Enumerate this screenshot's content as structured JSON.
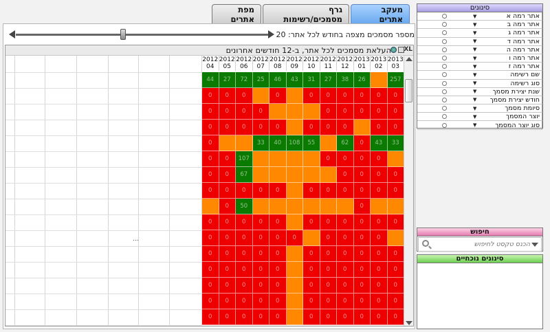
{
  "tabs": [
    {
      "label": "מפת אתרים",
      "active": false
    },
    {
      "label": "גרף מסמכים/רשימות",
      "active": false
    },
    {
      "label": "מעקב אתרים",
      "active": true
    }
  ],
  "slider": {
    "label": "מספר מסמכים מצפה בחודש לכל אתר: 20",
    "value": 20
  },
  "grid": {
    "title": "העלאת מסמכים לכל אתר, ב-12 חודשים אחרונים",
    "export_label": "XL",
    "ellipsis": "...",
    "months": [
      {
        "year": "2012",
        "month": "04"
      },
      {
        "year": "2012",
        "month": "05"
      },
      {
        "year": "2012",
        "month": "06"
      },
      {
        "year": "2012",
        "month": "07"
      },
      {
        "year": "2012",
        "month": "08"
      },
      {
        "year": "2012",
        "month": "09"
      },
      {
        "year": "2012",
        "month": "10"
      },
      {
        "year": "2012",
        "month": "11"
      },
      {
        "year": "2012",
        "month": "12"
      },
      {
        "year": "2013",
        "month": "01"
      },
      {
        "year": "2013",
        "month": "02"
      },
      {
        "year": "2013",
        "month": "03"
      }
    ],
    "rows": [
      [
        [
          "g",
          "44"
        ],
        [
          "g",
          "27"
        ],
        [
          "g",
          "72"
        ],
        [
          "g",
          "25"
        ],
        [
          "g",
          "46"
        ],
        [
          "g",
          "43"
        ],
        [
          "g",
          "31"
        ],
        [
          "g",
          "27"
        ],
        [
          "g",
          "38"
        ],
        [
          "g",
          "26"
        ],
        [
          "o",
          ""
        ],
        [
          "g",
          "257"
        ]
      ],
      [
        [
          "r",
          "0"
        ],
        [
          "r",
          "0"
        ],
        [
          "r",
          "0"
        ],
        [
          "o",
          ""
        ],
        [
          "r",
          "0"
        ],
        [
          "o",
          ""
        ],
        [
          "r",
          "0"
        ],
        [
          "r",
          "0"
        ],
        [
          "r",
          "0"
        ],
        [
          "r",
          "0"
        ],
        [
          "r",
          "0"
        ],
        [
          "r",
          "0"
        ]
      ],
      [
        [
          "r",
          "0"
        ],
        [
          "r",
          "0"
        ],
        [
          "r",
          "0"
        ],
        [
          "r",
          "0"
        ],
        [
          "o",
          ""
        ],
        [
          "o",
          ""
        ],
        [
          "o",
          ""
        ],
        [
          "r",
          "0"
        ],
        [
          "r",
          "0"
        ],
        [
          "r",
          "0"
        ],
        [
          "r",
          "0"
        ],
        [
          "r",
          "0"
        ]
      ],
      [
        [
          "r",
          "0"
        ],
        [
          "r",
          "0"
        ],
        [
          "r",
          "0"
        ],
        [
          "r",
          "0"
        ],
        [
          "r",
          "0"
        ],
        [
          "o",
          ""
        ],
        [
          "r",
          "0"
        ],
        [
          "r",
          "0"
        ],
        [
          "r",
          "0"
        ],
        [
          "o",
          ""
        ],
        [
          "r",
          "0"
        ],
        [
          "r",
          "0"
        ]
      ],
      [
        [
          "r",
          "0"
        ],
        [
          "o",
          ""
        ],
        [
          "o",
          ""
        ],
        [
          "g",
          "33"
        ],
        [
          "g",
          "40"
        ],
        [
          "g",
          "108"
        ],
        [
          "g",
          "55"
        ],
        [
          "o",
          ""
        ],
        [
          "g",
          "62"
        ],
        [
          "r",
          "0"
        ],
        [
          "g",
          "43"
        ],
        [
          "g",
          "33"
        ]
      ],
      [
        [
          "r",
          "0"
        ],
        [
          "r",
          "0"
        ],
        [
          "g",
          "107"
        ],
        [
          "o",
          ""
        ],
        [
          "o",
          ""
        ],
        [
          "o",
          ""
        ],
        [
          "o",
          ""
        ],
        [
          "r",
          "0"
        ],
        [
          "r",
          "0"
        ],
        [
          "r",
          "0"
        ],
        [
          "r",
          "0"
        ],
        [
          "o",
          ""
        ]
      ],
      [
        [
          "r",
          "0"
        ],
        [
          "r",
          "0"
        ],
        [
          "g",
          "67"
        ],
        [
          "o",
          ""
        ],
        [
          "o",
          ""
        ],
        [
          "o",
          ""
        ],
        [
          "o",
          ""
        ],
        [
          "o",
          ""
        ],
        [
          "r",
          "0"
        ],
        [
          "r",
          "0"
        ],
        [
          "r",
          "0"
        ],
        [
          "r",
          "0"
        ]
      ],
      [
        [
          "r",
          "0"
        ],
        [
          "r",
          "0"
        ],
        [
          "r",
          "0"
        ],
        [
          "r",
          "0"
        ],
        [
          "r",
          "0"
        ],
        [
          "o",
          ""
        ],
        [
          "r",
          "0"
        ],
        [
          "r",
          "0"
        ],
        [
          "r",
          "0"
        ],
        [
          "r",
          "0"
        ],
        [
          "r",
          "0"
        ],
        [
          "r",
          "0"
        ]
      ],
      [
        [
          "o",
          ""
        ],
        [
          "r",
          "0"
        ],
        [
          "g",
          "50"
        ],
        [
          "o",
          ""
        ],
        [
          "o",
          ""
        ],
        [
          "o",
          ""
        ],
        [
          "o",
          ""
        ],
        [
          "o",
          ""
        ],
        [
          "o",
          ""
        ],
        [
          "r",
          "0"
        ],
        [
          "o",
          ""
        ],
        [
          "o",
          ""
        ]
      ],
      [
        [
          "r",
          "0"
        ],
        [
          "r",
          "0"
        ],
        [
          "r",
          "0"
        ],
        [
          "r",
          "0"
        ],
        [
          "r",
          "0"
        ],
        [
          "o",
          ""
        ],
        [
          "r",
          "0"
        ],
        [
          "r",
          "0"
        ],
        [
          "r",
          "0"
        ],
        [
          "r",
          "0"
        ],
        [
          "r",
          "0"
        ],
        [
          "r",
          "0"
        ]
      ],
      [
        [
          "r",
          "0"
        ],
        [
          "r",
          "0"
        ],
        [
          "r",
          "0"
        ],
        [
          "r",
          "0"
        ],
        [
          "r",
          "0"
        ],
        [
          "r",
          "0"
        ],
        [
          "o",
          ""
        ],
        [
          "r",
          "0"
        ],
        [
          "r",
          "0"
        ],
        [
          "r",
          "0"
        ],
        [
          "r",
          "0"
        ],
        [
          "o",
          ""
        ]
      ],
      [
        [
          "r",
          "0"
        ],
        [
          "r",
          "0"
        ],
        [
          "r",
          "0"
        ],
        [
          "r",
          "0"
        ],
        [
          "r",
          "0"
        ],
        [
          "o",
          ""
        ],
        [
          "r",
          "0"
        ],
        [
          "r",
          "0"
        ],
        [
          "r",
          "0"
        ],
        [
          "r",
          "0"
        ],
        [
          "r",
          "0"
        ],
        [
          "r",
          "0"
        ]
      ],
      [
        [
          "r",
          "0"
        ],
        [
          "r",
          "0"
        ],
        [
          "r",
          "0"
        ],
        [
          "r",
          "0"
        ],
        [
          "r",
          "0"
        ],
        [
          "o",
          ""
        ],
        [
          "r",
          "0"
        ],
        [
          "r",
          "0"
        ],
        [
          "r",
          "0"
        ],
        [
          "r",
          "0"
        ],
        [
          "r",
          "0"
        ],
        [
          "r",
          "0"
        ]
      ],
      [
        [
          "r",
          "0"
        ],
        [
          "r",
          "0"
        ],
        [
          "r",
          "0"
        ],
        [
          "r",
          "0"
        ],
        [
          "r",
          "0"
        ],
        [
          "o",
          ""
        ],
        [
          "r",
          "0"
        ],
        [
          "r",
          "0"
        ],
        [
          "r",
          "0"
        ],
        [
          "r",
          "0"
        ],
        [
          "r",
          "0"
        ],
        [
          "r",
          "0"
        ]
      ],
      [
        [
          "r",
          "0"
        ],
        [
          "r",
          "0"
        ],
        [
          "r",
          "0"
        ],
        [
          "r",
          "0"
        ],
        [
          "r",
          "0"
        ],
        [
          "o",
          ""
        ],
        [
          "r",
          "0"
        ],
        [
          "r",
          "0"
        ],
        [
          "r",
          "0"
        ],
        [
          "r",
          "0"
        ],
        [
          "r",
          "0"
        ],
        [
          "r",
          "0"
        ]
      ],
      [
        [
          "r",
          "0"
        ],
        [
          "r",
          "0"
        ],
        [
          "r",
          "0"
        ],
        [
          "r",
          "0"
        ],
        [
          "r",
          "0"
        ],
        [
          "o",
          ""
        ],
        [
          "r",
          "0"
        ],
        [
          "r",
          "0"
        ],
        [
          "r",
          "0"
        ],
        [
          "r",
          "0"
        ],
        [
          "r",
          "0"
        ],
        [
          "r",
          "0"
        ]
      ]
    ]
  },
  "filters": {
    "title": "סינונים",
    "items": [
      "אתר רמה א",
      "אתר רמה ב",
      "אתר רמה ג",
      "אתר רמה ד",
      "אתר רמה ה",
      "אתר רמה ו",
      "אתר רמה ז",
      "שם רשימה",
      "סוג רשימה",
      "שנת יצירת מסמך",
      "חודש יצירת מסמך",
      "סיומת מסמך",
      "יוצר המסמך",
      "סוג יוצר המסמך"
    ]
  },
  "search": {
    "title": "חיפוש",
    "placeholder": "הכנס טקסט לחיפוש"
  },
  "current_filters": {
    "title": "סינונים נוכחיים"
  },
  "colors": {
    "red": "#ee0000",
    "orange": "#ff8800",
    "green": "#0a7a00",
    "active_tab": "#6aa9ef"
  }
}
